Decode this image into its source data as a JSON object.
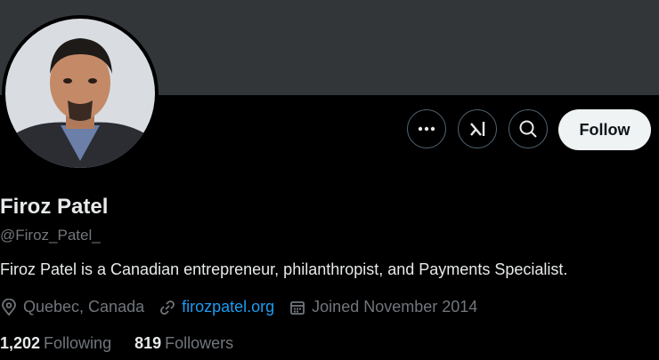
{
  "profile": {
    "name": "Firoz Patel",
    "handle": "@Firoz_Patel_",
    "bio": "Firoz Patel is a Canadian entrepreneur, philanthropist, and Payments Specialist.",
    "location": "Quebec, Canada",
    "website": "firozpatel.org",
    "joined": "Joined November 2014",
    "following_count": "1,202",
    "following_label": "Following",
    "followers_count": "819",
    "followers_label": "Followers"
  },
  "actions": {
    "follow_label": "Follow",
    "more_icon": "more-icon",
    "grok_icon": "grok-icon",
    "search_icon": "search-icon"
  },
  "colors": {
    "background": "#000000",
    "banner": "#333639",
    "link": "#1d9bf0",
    "secondary_text": "#71767b",
    "follow_bg": "#eff3f4"
  }
}
